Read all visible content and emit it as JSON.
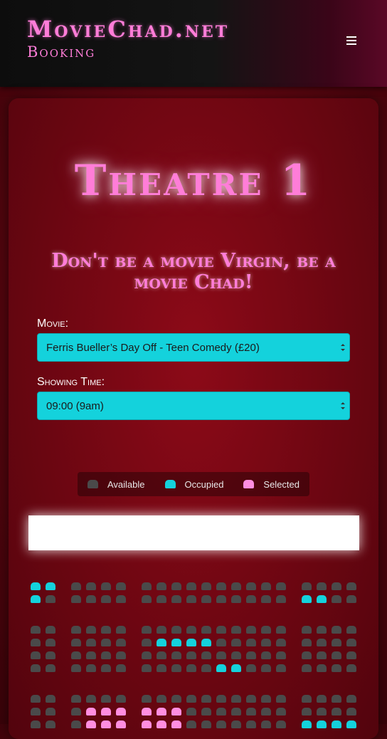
{
  "brand": {
    "title": "MovieChad.net",
    "subtitle": "Booking"
  },
  "nav": {
    "menu_icon": "bars-icon"
  },
  "theatre": {
    "title": "Theatre 1",
    "slogan": "Don't be a movie Virgin, be a movie Chad!"
  },
  "form": {
    "movie_label": "Movie:",
    "movie_value": "Ferris Bueller’s Day Off - Teen Comedy (£20)",
    "time_label": "Showing Time:",
    "time_value": "09:00 (9am)"
  },
  "legend": {
    "available": "Available",
    "occupied": "Occupied",
    "selected": "Selected"
  },
  "colors": {
    "available": "#4a4a4a",
    "occupied": "#14d2dc",
    "selected": "#ff8ee0",
    "brand": "#ff7dd8"
  },
  "seating": {
    "rows": [
      [
        "OO",
        "AAAA",
        "AAAAAAAAAA",
        "AAAA"
      ],
      [
        "OA",
        "AAAA",
        "AAAAAAAAAA",
        "OOAA"
      ],
      [
        "AA",
        "AAAA",
        "AAAAAAAAAA",
        "AAAA"
      ],
      [
        "AA",
        "AAAA",
        "AOOOOAAAAA",
        "AAAA"
      ],
      [
        "AA",
        "AAAA",
        "AAAAAAAAAA",
        "AAAA"
      ],
      [
        "AA",
        "AAAA",
        "AAAAAOOAAA",
        "AAAA"
      ],
      [
        "AA",
        "AAAA",
        "AAAAAAAAAA",
        "AAAA"
      ],
      [
        "AA",
        "ASSS",
        "SSSAAAAAAA",
        "AAAA"
      ],
      [
        "AA",
        "ASSS",
        "SSSAAAAAAA",
        "OOOO"
      ]
    ]
  }
}
